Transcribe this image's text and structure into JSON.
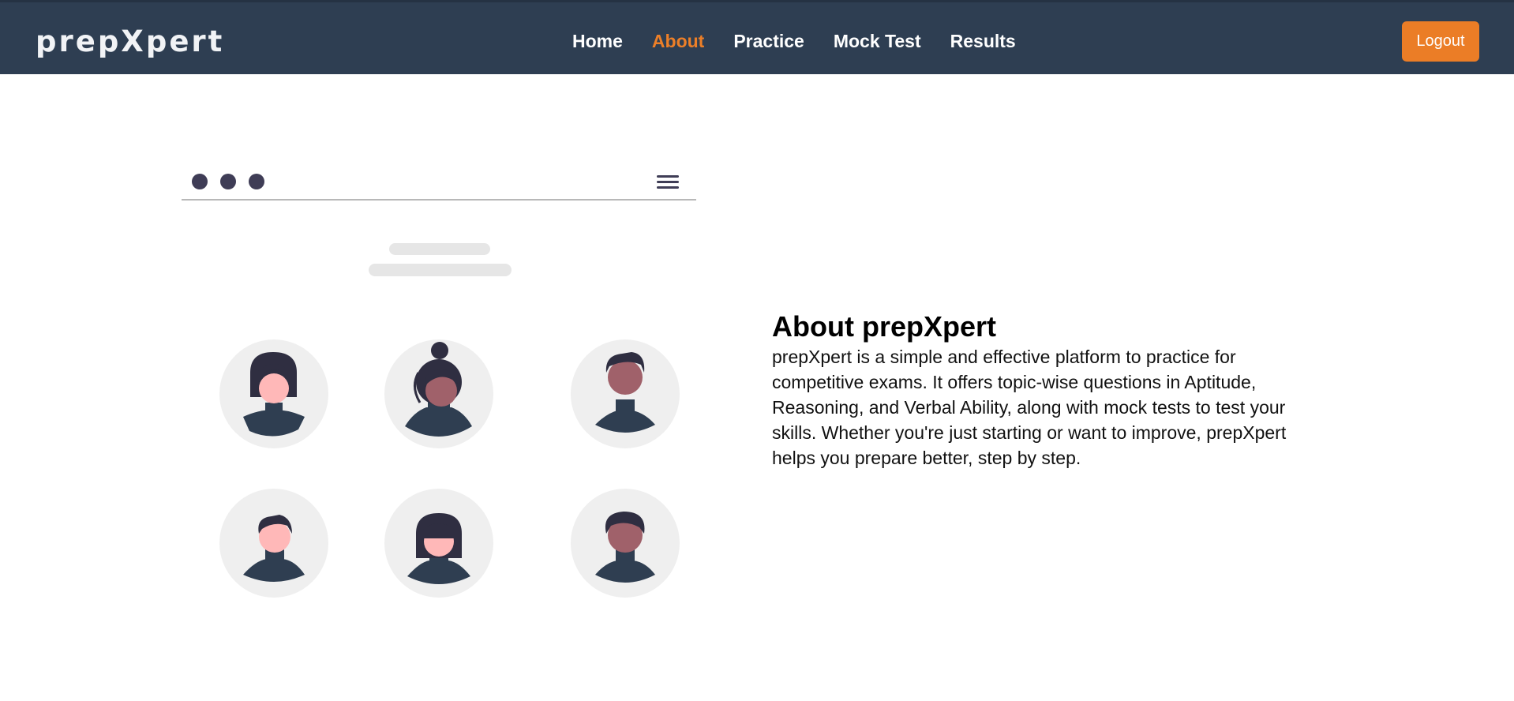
{
  "header": {
    "brand": "prepXpert",
    "nav": [
      {
        "label": "Home",
        "active": false
      },
      {
        "label": "About",
        "active": true
      },
      {
        "label": "Practice",
        "active": false
      },
      {
        "label": "Mock Test",
        "active": false
      },
      {
        "label": "Results",
        "active": false
      }
    ],
    "logout_label": "Logout"
  },
  "about": {
    "title": "About prepXpert",
    "body": "prepXpert is a simple and effective platform to practice for competitive exams. It offers topic-wise questions in Aptitude, Reasoning, and Verbal Ability, along with mock tests to test your skills. Whether you're just starting or want to improve, prepXpert helps you prepare better, step by step."
  },
  "colors": {
    "navbar": "#2e3e52",
    "accent": "#ec7f28",
    "avatar_bg": "#efefef",
    "dark": "#3f3d56"
  },
  "illustration": {
    "icons": [
      "window-dot-icon",
      "hamburger-menu-icon",
      "user-avatar-icon"
    ]
  }
}
